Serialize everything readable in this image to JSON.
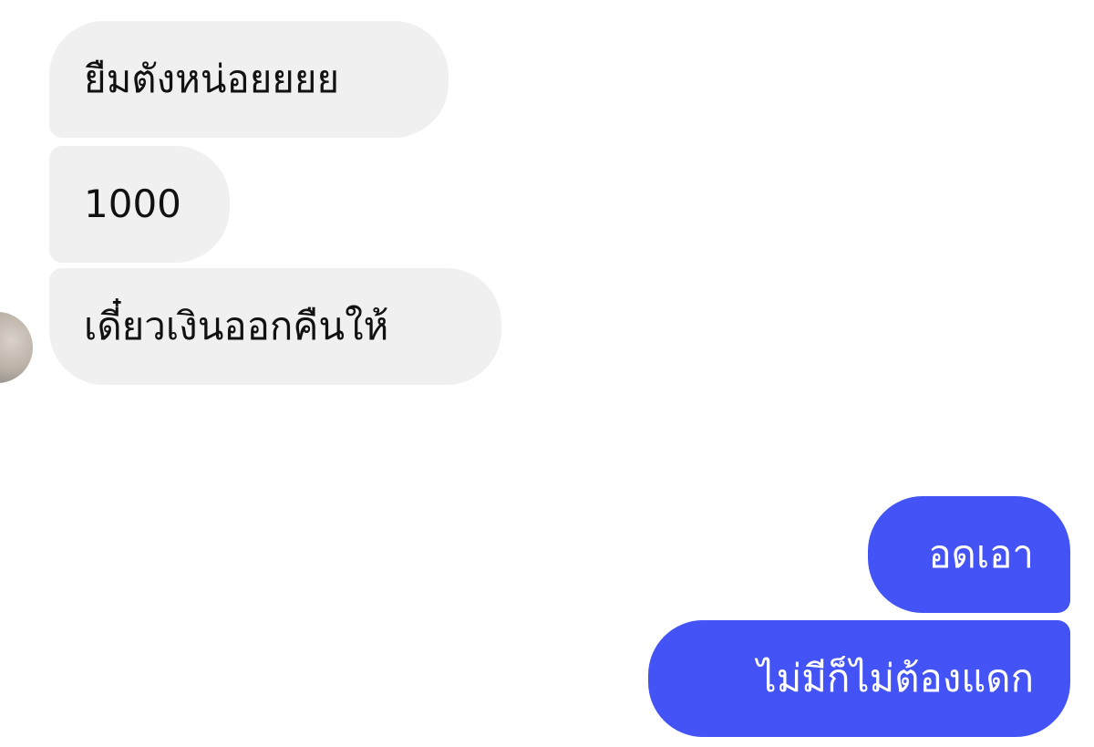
{
  "chat": {
    "incoming": [
      {
        "text": "ยืมตังหน่อยยยย"
      },
      {
        "text": "1000"
      },
      {
        "text": "เดี๋ยวเงินออกคืนให้"
      }
    ],
    "outgoing": [
      {
        "text": "อดเอา"
      },
      {
        "text": "ไม่มีก็ไม่ต้องแดก"
      }
    ]
  },
  "colors": {
    "incoming_bubble": "#f0f0f0",
    "outgoing_bubble": "#4353f5",
    "background": "#ffffff"
  }
}
